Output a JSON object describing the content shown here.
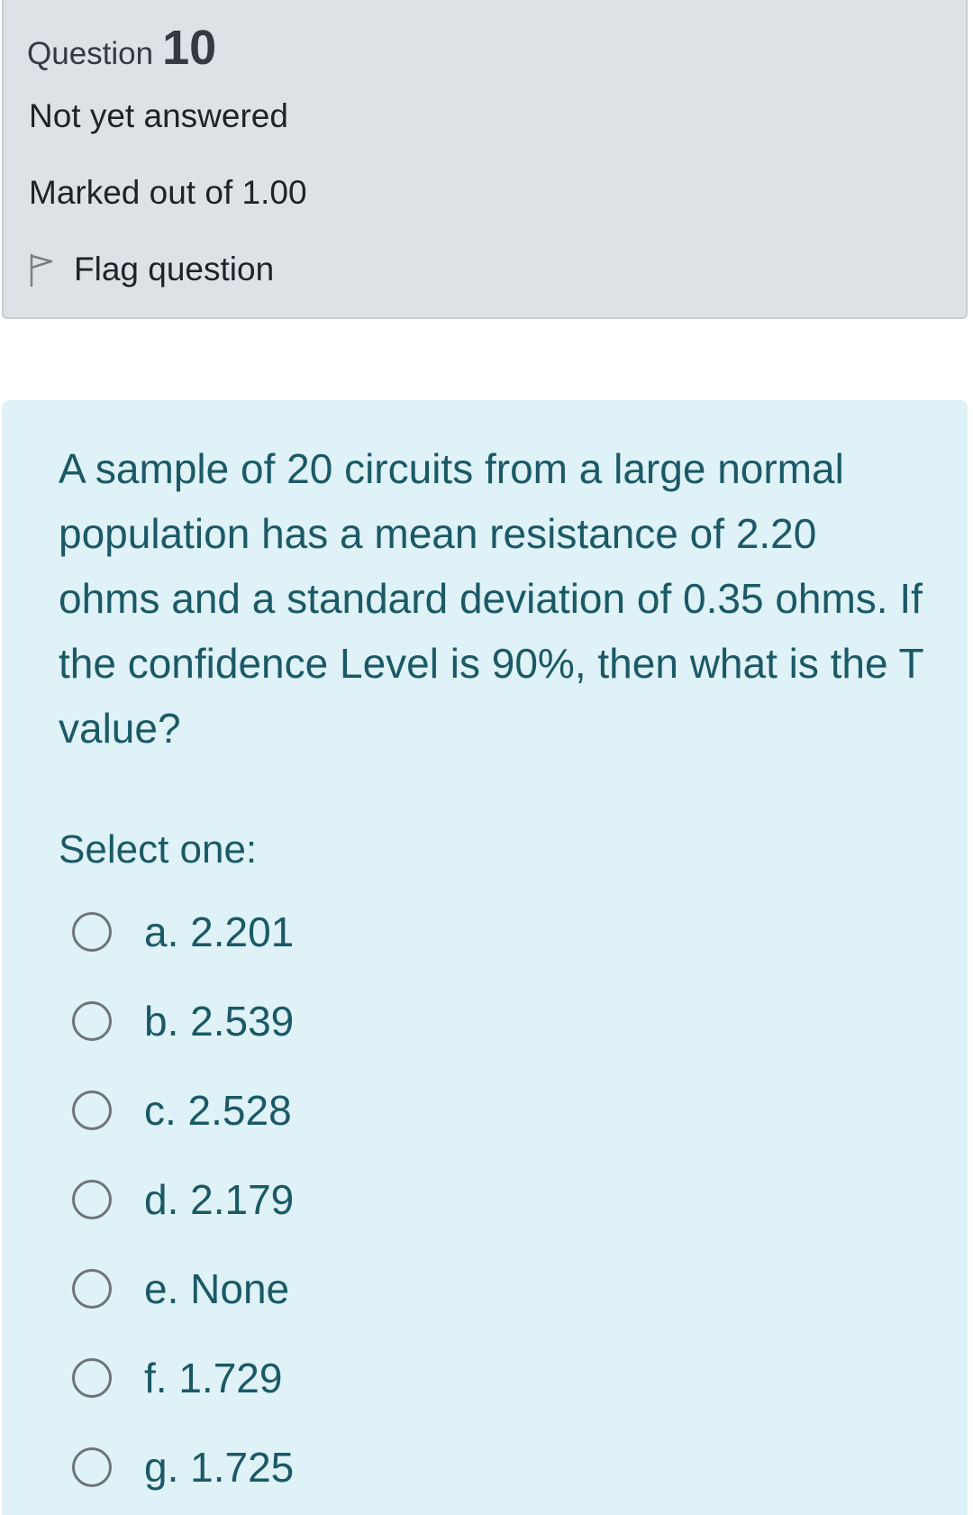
{
  "info": {
    "question_word": "Question",
    "question_number": "10",
    "state": "Not yet answered",
    "grade": "Marked out of 1.00",
    "flag_label": "Flag question"
  },
  "content": {
    "question_text": "A sample of 20 circuits from a large normal population has a mean resistance of 2.20 ohms and a standard deviation of 0.35 ohms. If the confidence Level is 90%, then what is the T value?",
    "prompt": "Select one:",
    "answers": [
      {
        "label": "a. 2.201",
        "selected": false
      },
      {
        "label": "b. 2.539",
        "selected": false
      },
      {
        "label": "c. 2.528",
        "selected": false
      },
      {
        "label": "d. 2.179",
        "selected": false
      },
      {
        "label": "e. None",
        "selected": false
      },
      {
        "label": "f. 1.729",
        "selected": false
      },
      {
        "label": "g. 1.725",
        "selected": false
      }
    ]
  },
  "colors": {
    "info_background": "#dee2e6",
    "content_background": "#def2f8",
    "content_text": "#1b5966",
    "info_text": "#1f2328"
  }
}
